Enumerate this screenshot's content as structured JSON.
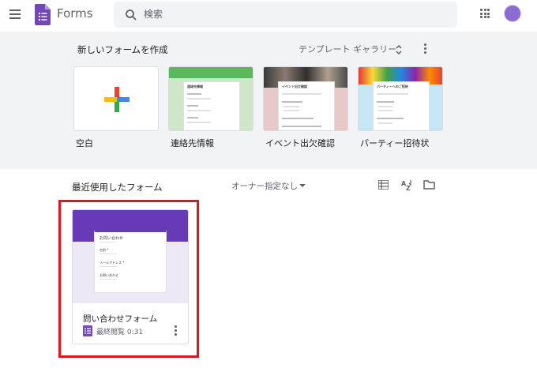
{
  "app": {
    "title": "Forms"
  },
  "search": {
    "placeholder": "検索"
  },
  "create": {
    "title": "新しいフォームを作成",
    "gallery_label": "テンプレート ギャラリー"
  },
  "templates": [
    {
      "label": "空白"
    },
    {
      "label": "連絡先情報",
      "preview_title": "連絡先情報"
    },
    {
      "label": "イベント出欠確認",
      "preview_title": "イベント出欠確認"
    },
    {
      "label": "パーティー招待状",
      "preview_title": "パーティーへのご招待"
    }
  ],
  "recent": {
    "title": "最近使用したフォーム",
    "owner_filter": "オーナー指定なし"
  },
  "forms": [
    {
      "name": "問い合わせフォーム",
      "meta": "最終閲覧 0:31",
      "preview_title": "お問い合わせ",
      "preview_fields": [
        "名前 *",
        "メールアドレス *",
        "お問い合わせ"
      ]
    }
  ],
  "colors": {
    "brand_purple": "#673ab7",
    "highlight_red": "#e3141b",
    "section_bg": "#f1f3f4"
  },
  "icons": [
    "menu-icon",
    "forms-logo-icon",
    "search-icon",
    "apps-grid-icon",
    "avatar",
    "unfold-icon",
    "more-vert-icon",
    "plus-icon",
    "list-view-icon",
    "sort-az-icon",
    "folder-icon",
    "form-icon"
  ]
}
